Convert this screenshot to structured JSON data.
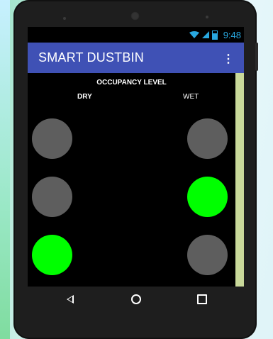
{
  "status_bar": {
    "time": "9:48"
  },
  "app_bar": {
    "title": "SMART DUSTBIN",
    "overflow_icon": "more-vert-icon"
  },
  "content": {
    "title": "OCCUPANCY LEVEL",
    "dry_label": "DRY",
    "wet_label": "WET",
    "dry_levels": [
      {
        "state": "off",
        "color": "#5e5e5e"
      },
      {
        "state": "off",
        "color": "#5e5e5e"
      },
      {
        "state": "on",
        "color": "#00ff00"
      }
    ],
    "wet_levels": [
      {
        "state": "off",
        "color": "#5e5e5e"
      },
      {
        "state": "on",
        "color": "#00ff00"
      },
      {
        "state": "off",
        "color": "#5e5e5e"
      }
    ]
  },
  "nav_bar": {
    "back_icon": "back-icon",
    "home_icon": "home-icon",
    "recents_icon": "recents-icon"
  }
}
